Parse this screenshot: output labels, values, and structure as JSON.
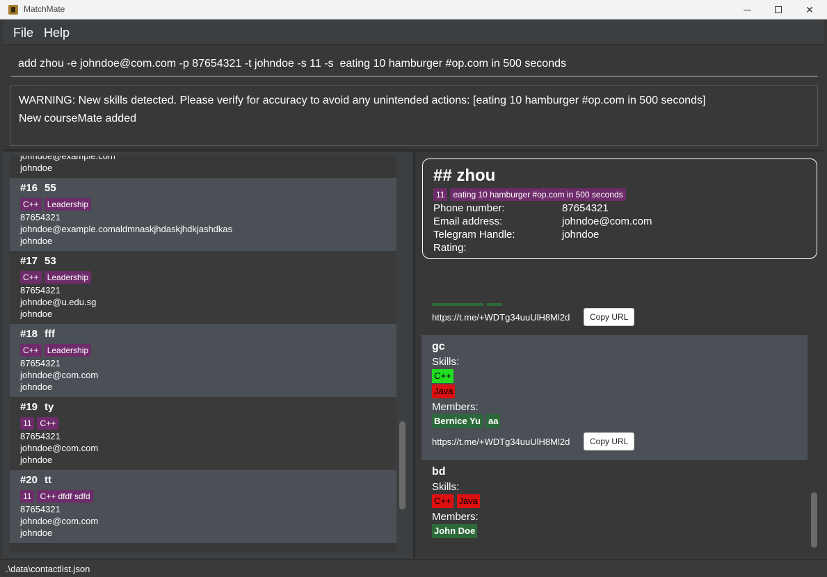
{
  "window": {
    "title": "MatchMate",
    "icon": "app-icon",
    "controls": {
      "minimize": "minimize-icon",
      "maximize": "maximize-icon",
      "close": "✕"
    }
  },
  "menu": {
    "file": "File",
    "help": "Help"
  },
  "command": {
    "value": "add zhou -e johndoe@com.com -p 87654321 -t johndoe -s 11 -s  eating 10 hamburger #op.com in 500 seconds"
  },
  "result": {
    "line1": "WARNING: New skills detected. Please verify for accuracy to avoid any unintended actions: [eating 10 hamburger #op.com in 500 seconds]",
    "line2": "New courseMate added"
  },
  "contact_list": {
    "partial_top": {
      "line1": "johndoe@example.com",
      "line2": "johndoe"
    },
    "items": [
      {
        "index": "#16",
        "name": "55",
        "tags": [
          "C++",
          "Leadership"
        ],
        "phone": "87654321",
        "email": "johndoe@example.comaldmnaskjhdaskjhdkjashdkas",
        "telegram": "johndoe"
      },
      {
        "index": "#17",
        "name": "53",
        "tags": [
          "C++",
          "Leadership"
        ],
        "phone": "87654321",
        "email": "johndoe@u.edu.sg",
        "telegram": "johndoe"
      },
      {
        "index": "#18",
        "name": "fff",
        "tags": [
          "C++",
          "Leadership"
        ],
        "phone": "87654321",
        "email": "johndoe@com.com",
        "telegram": "johndoe"
      },
      {
        "index": "#19",
        "name": "ty",
        "tags": [
          "11",
          "C++"
        ],
        "phone": "87654321",
        "email": "johndoe@com.com",
        "telegram": "johndoe"
      },
      {
        "index": "#20",
        "name": "tt",
        "tags": [
          "11",
          "C++ dfdf sdfd"
        ],
        "phone": "87654321",
        "email": "johndoe@com.com",
        "telegram": "johndoe"
      }
    ]
  },
  "detail": {
    "name": "##  zhou",
    "tags": [
      "11",
      "eating 10 hamburger #op.com in 500 seconds"
    ],
    "phone_label": "Phone number:",
    "phone": "87654321",
    "email_label": "Email address:",
    "email": "johndoe@com.com",
    "telegram_label": "Telegram Handle:",
    "telegram": "johndoe",
    "rating_label": "Rating:",
    "rating": ""
  },
  "groups": {
    "partial": {
      "url": "https://t.me/+WDTg34uuUlH8Ml2d",
      "copy_label": "Copy URL"
    },
    "items": [
      {
        "name": "gc",
        "skills_label": "Skills:",
        "skills": [
          {
            "name": "C++",
            "color": "#22dd22"
          },
          {
            "name": "Java",
            "color": "#dd1111"
          }
        ],
        "members_label": "Members:",
        "members": [
          "Bernice Yu",
          "aa"
        ],
        "url": "https://t.me/+WDTg34uuUlH8Ml2d",
        "copy_label": "Copy URL"
      },
      {
        "name": "bd",
        "skills_label": "Skills:",
        "skills": [
          {
            "name": "C++",
            "color": "#dd1111"
          },
          {
            "name": "Java",
            "color": "#dd1111"
          }
        ],
        "members_label": "Members:",
        "members": [
          "John Doe"
        ]
      }
    ]
  },
  "status": {
    "path": ".\\data\\contactlist.json"
  },
  "colors": {
    "tag": "#6e2c6b",
    "member": "#2d6a3a",
    "skill_good": "#22dd22",
    "skill_bad": "#dd1111"
  }
}
